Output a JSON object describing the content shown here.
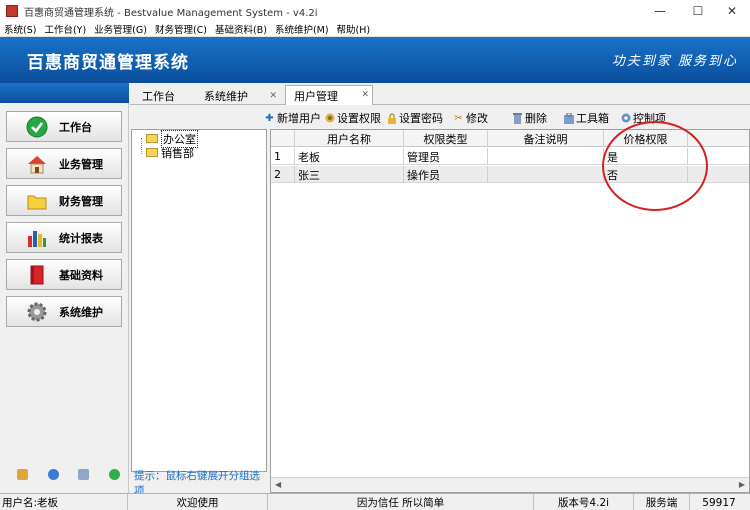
{
  "window": {
    "title": "百惠商贸通管理系统 - Bestvalue Management System - v4.2i",
    "minimize": "—",
    "maximize": "☐",
    "close": "✕"
  },
  "menu": [
    "系统(S)",
    "工作台(Y)",
    "业务管理(G)",
    "财务管理(C)",
    "基础资料(B)",
    "系统维护(M)",
    "帮助(H)"
  ],
  "banner": {
    "brand": "百惠商贸通管理系统",
    "slogan": "功夫到家 服务到心"
  },
  "nav": [
    {
      "label": "工作台",
      "icon": "check-icon"
    },
    {
      "label": "业务管理",
      "icon": "house-icon"
    },
    {
      "label": "财务管理",
      "icon": "folder-icon"
    },
    {
      "label": "统计报表",
      "icon": "bar-chart-icon"
    },
    {
      "label": "基础资料",
      "icon": "book-icon"
    },
    {
      "label": "系统维护",
      "icon": "gear-icon"
    }
  ],
  "tabs": [
    {
      "label": "工作台",
      "closable": false,
      "active": false
    },
    {
      "label": "系统维护",
      "closable": true,
      "active": false
    },
    {
      "label": "用户管理",
      "closable": true,
      "active": true
    }
  ],
  "toolbar": [
    {
      "label": "新增用户",
      "icon": "plus-icon"
    },
    {
      "label": "设置权限",
      "icon": "permission-icon"
    },
    {
      "label": "设置密码",
      "icon": "lock-icon"
    },
    {
      "label": "修改",
      "icon": "edit-icon"
    },
    {
      "label": "删除",
      "icon": "trash-icon"
    },
    {
      "label": "工具箱",
      "icon": "toolbox-icon"
    },
    {
      "label": "控制项",
      "icon": "control-icon"
    }
  ],
  "tree": [
    {
      "label": "办公室",
      "selected": true
    },
    {
      "label": "销售部",
      "selected": false
    }
  ],
  "hint": "提示：鼠标右键展开分组选项",
  "grid": {
    "columns": [
      "",
      "用户名称",
      "权限类型",
      "备注说明",
      "价格权限"
    ],
    "rows": [
      [
        "1",
        "老板",
        "管理员",
        "",
        "是"
      ],
      [
        "2",
        "张三",
        "操作员",
        "",
        "否"
      ]
    ]
  },
  "status": {
    "user": "用户名:老板",
    "welcome": "欢迎使用",
    "motto": "因为信任 所以简单",
    "version": "版本号4.2i",
    "server": "服务端",
    "port": "59917"
  },
  "colors": {
    "banner": "#0a4f9c",
    "annotation_circle": "#d42020",
    "hint_text": "#1b6fc2"
  }
}
